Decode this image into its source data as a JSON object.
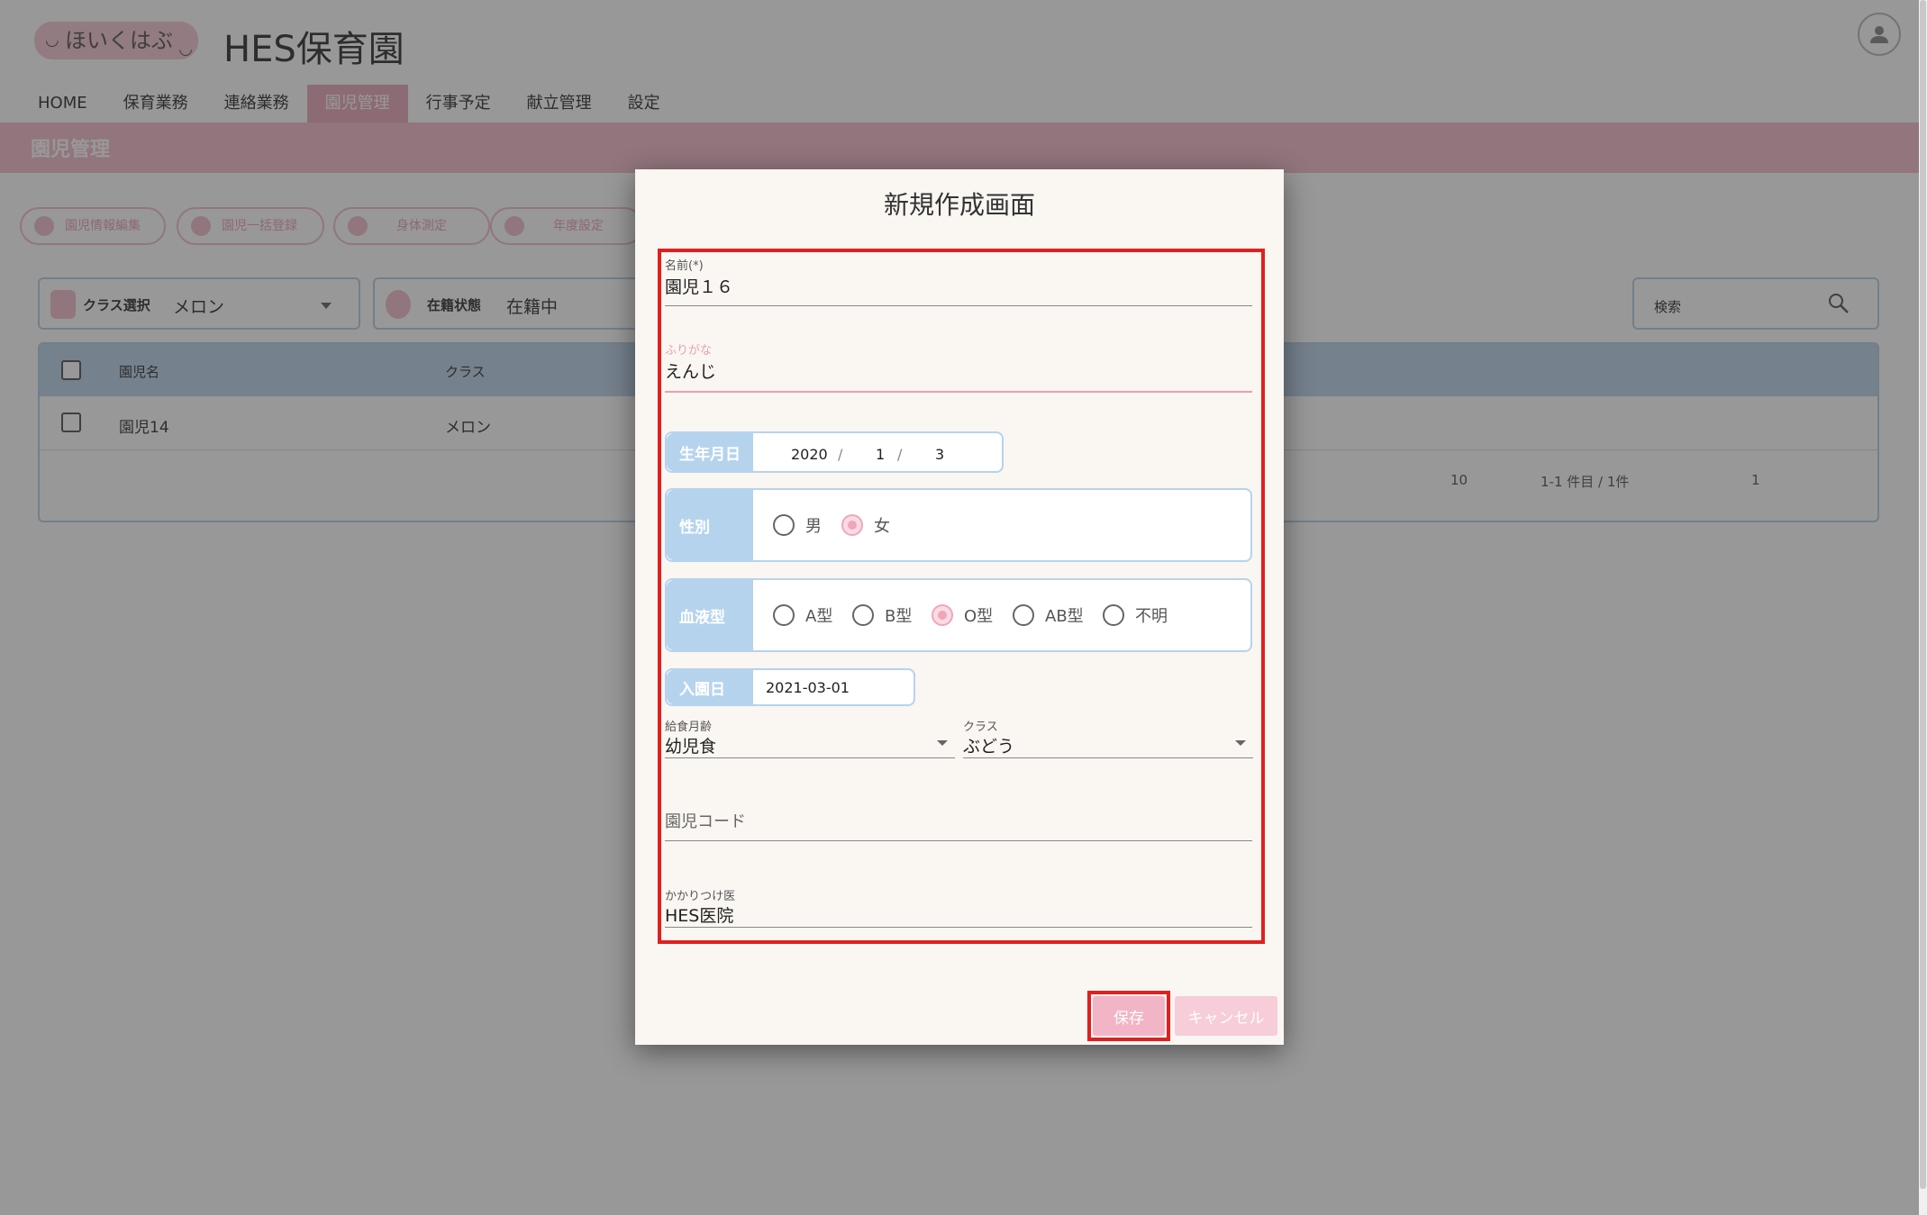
{
  "header": {
    "logo_text": "ほいくはぶ",
    "app_title": "HES保育園"
  },
  "nav": {
    "items": [
      "HOME",
      "保育業務",
      "連絡業務",
      "園児管理",
      "行事予定",
      "献立管理",
      "設定"
    ],
    "active": "園児管理"
  },
  "page": {
    "section_title": "園児管理"
  },
  "toolbar": {
    "buttons": [
      "園児情報編集",
      "園児一括登録",
      "身体測定",
      "年度設定"
    ]
  },
  "filters": {
    "class_label": "クラス選択",
    "class_value": "メロン",
    "status_label": "在籍状態",
    "status_value": "在籍中",
    "search_label": "検索"
  },
  "table": {
    "headers": [
      "園児名",
      "クラス"
    ],
    "rows": [
      {
        "name": "園児14",
        "class": "メロン"
      }
    ],
    "pager": {
      "per_page": "10",
      "range": "1-1 件目 / 1件",
      "page": "1"
    }
  },
  "dialog": {
    "title": "新規作成画面",
    "name_label": "名前(*)",
    "name_value": "園児１６",
    "furigana_label": "ふりがな",
    "furigana_value": "えんじ",
    "birth_label": "生年月日",
    "birth_year": "2020",
    "birth_month": "1",
    "birth_day": "3",
    "gender_label": "性別",
    "gender_options": [
      "男",
      "女"
    ],
    "gender_selected": "女",
    "blood_label": "血液型",
    "blood_options": [
      "A型",
      "B型",
      "O型",
      "AB型",
      "不明"
    ],
    "blood_selected": "O型",
    "entry_label": "入園日",
    "entry_value": "2021-03-01",
    "meal_label": "給食月齢",
    "meal_value": "幼児食",
    "class_label": "クラス",
    "class_value": "ぶどう",
    "code_placeholder": "園児コード",
    "doctor_label": "かかりつけ医",
    "doctor_value": "HES医院",
    "save_label": "保存",
    "cancel_label": "キャンセル"
  },
  "colors": {
    "pink_accent": "#e9a9bb",
    "blue_label": "#b6d3ee",
    "highlight_red": "#e0201f"
  }
}
